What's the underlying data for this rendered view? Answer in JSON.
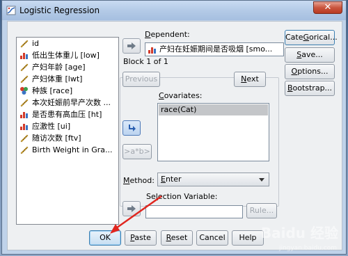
{
  "window": {
    "title": "Logistic Regression",
    "close_glyph": "✕"
  },
  "variables": [
    {
      "name": "id",
      "icon": "scale-ruler-icon"
    },
    {
      "name": "低出生体重儿 [low]",
      "icon": "bar-nominal-icon"
    },
    {
      "name": "产妇年龄 [age]",
      "icon": "scale-ruler-icon"
    },
    {
      "name": "产妇体重 [lwt]",
      "icon": "scale-ruler-icon"
    },
    {
      "name": "种族 [race]",
      "icon": "nominal-circles-icon"
    },
    {
      "name": "本次妊娠前早产次数 ...",
      "icon": "scale-ruler-icon"
    },
    {
      "name": "是否患有高血压 [ht]",
      "icon": "bar-nominal-icon"
    },
    {
      "name": "应激性 [ui]",
      "icon": "bar-nominal-icon"
    },
    {
      "name": "随访次数 [ftv]",
      "icon": "scale-ruler-icon"
    },
    {
      "name": "Birth Weight in Gra...",
      "icon": "scale-ruler-icon"
    }
  ],
  "dependent": {
    "label_prefix": "",
    "label_u": "D",
    "label_rest": "ependent:",
    "value": "产妇在妊娠期间是否吸烟 [smo..."
  },
  "block": {
    "label": "Block 1 of 1",
    "previous": "Previous",
    "next_u": "N",
    "next_rest": "ext"
  },
  "covariates": {
    "label_u": "C",
    "label_rest": "ovariates:",
    "items": [
      "race(Cat)"
    ]
  },
  "interaction_button": ">a*b>",
  "method": {
    "label_u": "M",
    "label_rest": "ethod:",
    "value_u": "E",
    "value_rest": "nter"
  },
  "selection": {
    "label_prefix": "Se",
    "label_u": "l",
    "label_rest": "ection Variable:",
    "rule_button": "Rule..."
  },
  "side_buttons": {
    "categorical_u": "G",
    "categorical_pre": "Cate",
    "categorical_post": "orical...",
    "save_u": "S",
    "save_rest": "ave...",
    "options_u": "O",
    "options_rest": "ptions...",
    "bootstrap_u": "B",
    "bootstrap_rest": "ootstrap..."
  },
  "bottom_buttons": {
    "ok": "OK",
    "paste_u": "P",
    "paste_rest": "aste",
    "reset_u": "R",
    "reset_rest": "eset",
    "cancel": "Cancel",
    "help": "Help"
  },
  "watermark": {
    "main": "Baidu 经验",
    "sub": "jingyan.baidu.com"
  }
}
